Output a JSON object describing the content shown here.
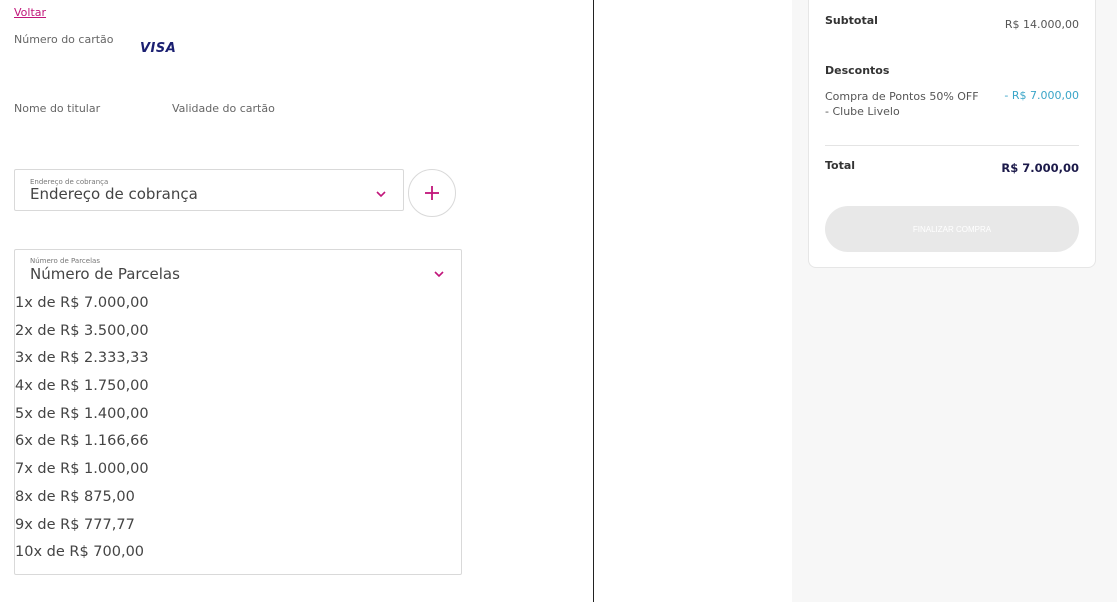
{
  "form": {
    "back_link": "Voltar",
    "card_number_label": "Número do cartão",
    "card_brand": "VISA",
    "holder_name_label": "Nome do titular",
    "expiry_label": "Validade do cartão",
    "billing_address": {
      "floating_label": "Endereço de cobrança",
      "value": "Endereço de cobrança"
    },
    "add_address_icon": "plus-icon",
    "installments": {
      "floating_label": "Número de Parcelas",
      "value": "Número de Parcelas",
      "options": [
        "1x de R$ 7.000,00",
        "2x de R$ 3.500,00",
        "3x de R$ 2.333,33",
        "4x de R$ 1.750,00",
        "5x de R$ 1.400,00",
        "6x de R$ 1.166,66",
        "7x de R$ 1.000,00",
        "8x de R$ 875,00",
        "9x de R$ 777,77",
        "10x de R$ 700,00"
      ]
    }
  },
  "summary": {
    "subtotal_label": "Subtotal",
    "subtotal_value": "R$ 14.000,00",
    "discounts_label": "Descontos",
    "discount_description": "Compra de Pontos 50% OFF - Clube Livelo",
    "discount_value": "- R$ 7.000,00",
    "total_label": "Total",
    "total_value": "R$ 7.000,00",
    "finish_button": "FINALIZAR COMPRA"
  },
  "colors": {
    "accent": "#c1157a",
    "discount": "#3aa5c8",
    "total": "#1c1a4a",
    "divider": "#222222"
  }
}
